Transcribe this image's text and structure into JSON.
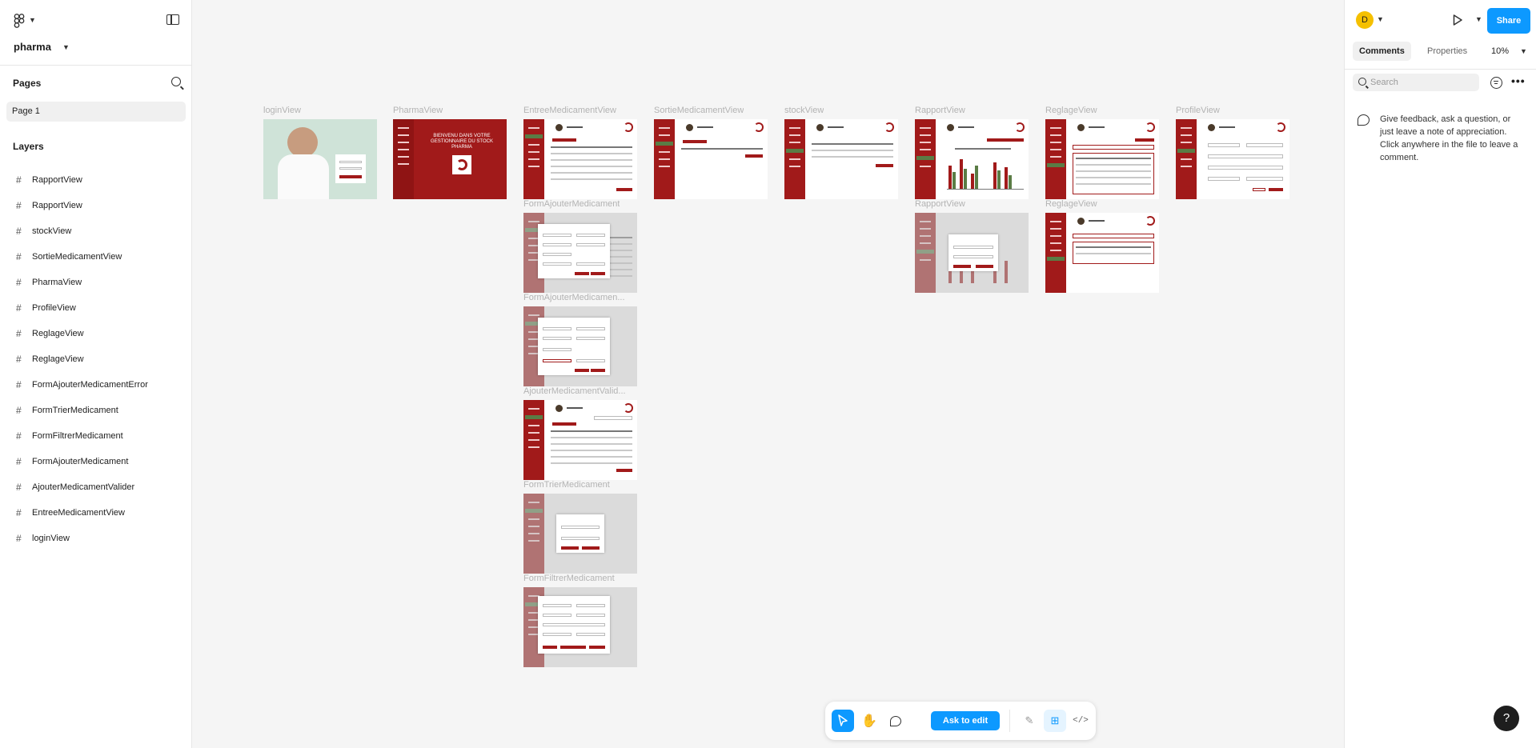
{
  "file": {
    "name": "pharma"
  },
  "pages": {
    "title": "Pages",
    "items": [
      "Page 1"
    ]
  },
  "layers": {
    "title": "Layers",
    "items": [
      "RapportView",
      "RapportView",
      "stockView",
      "SortieMedicamentView",
      "PharmaView",
      "ProfileView",
      "ReglageView",
      "ReglageView",
      "FormAjouterMedicamentError",
      "FormTrierMedicament",
      "FormFiltrerMedicament",
      "FormAjouterMedicament",
      "AjouterMedicamentValider",
      "EntreeMedicamentView",
      "loginView"
    ]
  },
  "frames": {
    "login": "loginView",
    "pharma": "PharmaView",
    "entree": "EntreeMedicamentView",
    "sortie": "SortieMedicamentView",
    "stock": "stockView",
    "rapport": "RapportView",
    "reglage": "ReglageView",
    "profile": "ProfileView",
    "form_ajouter": "FormAjouterMedicament",
    "rapport2": "RapportView",
    "reglage2": "ReglageView",
    "form_ajouter_error": "FormAjouterMedicamen...",
    "ajouter_valider": "AjouterMedicamentValid...",
    "form_trier": "FormTrierMedicament",
    "form_filtrer": "FormFiltrerMedicament",
    "pharma_title": "BIENVENU DANS VOTRE GESTIONNAIRE DU STOCK PHARMA"
  },
  "right_panel": {
    "avatar_letter": "D",
    "share": "Share",
    "tabs": {
      "comments": "Comments",
      "properties": "Properties"
    },
    "zoom": "10%",
    "search_placeholder": "Search",
    "more": "•••",
    "hint": "Give feedback, ask a question, or just leave a note of appreciation. Click anywhere in the file to leave a comment.",
    "help": "?"
  },
  "toolbar": {
    "ask_edit": "Ask to edit",
    "dev": "</>"
  },
  "colors": {
    "accent": "#0d99ff",
    "brand_red": "#a11a1a",
    "nav_green": "#5a7c45"
  },
  "icons": [
    "figma-logo-icon",
    "layout-toggle-icon",
    "search-icon",
    "frame-hash-icon",
    "play-icon",
    "filter-icon",
    "more-icon",
    "comment-icon",
    "move-tool-icon",
    "hand-tool-icon",
    "draw-icon",
    "design-mode-icon",
    "dev-mode-icon",
    "help-icon"
  ]
}
